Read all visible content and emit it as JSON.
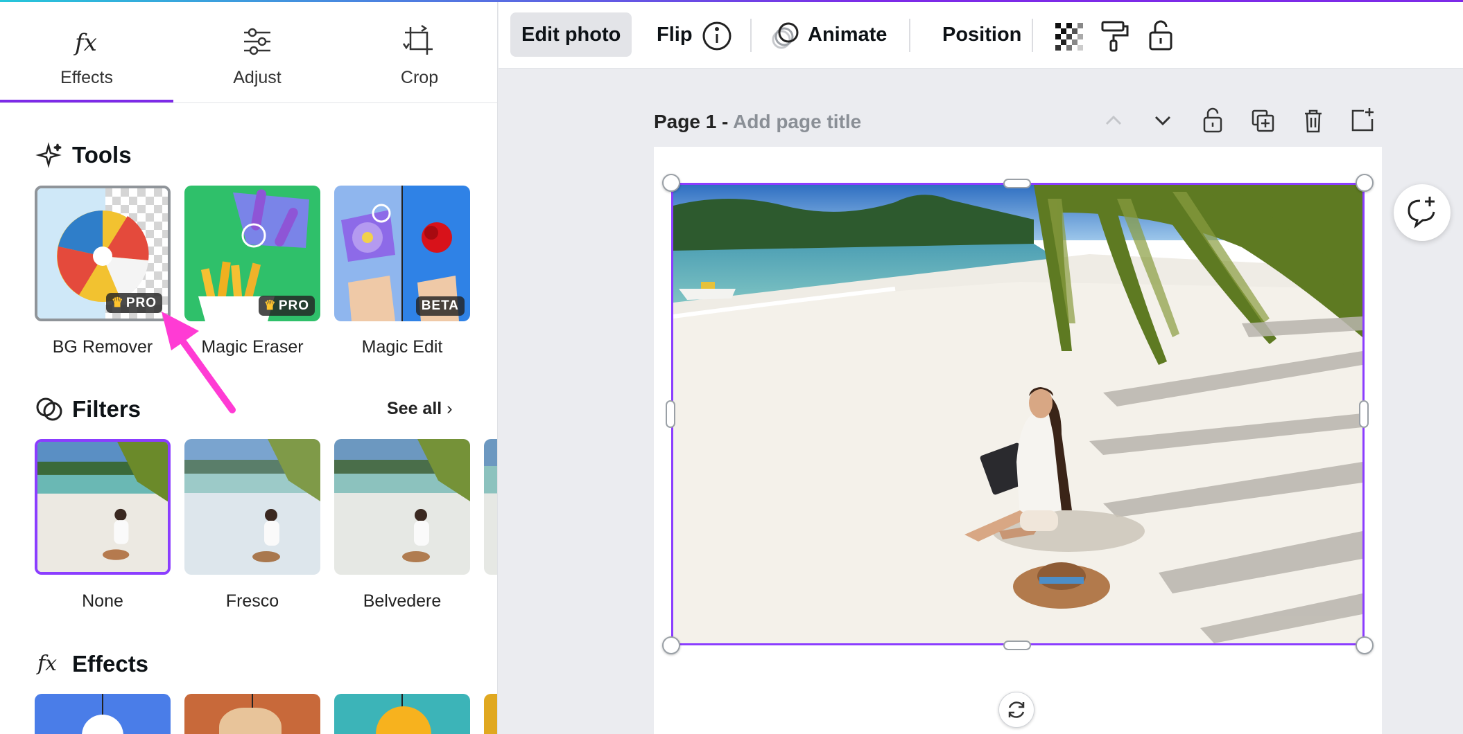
{
  "panel": {
    "tabs": [
      {
        "label": "Effects",
        "icon": "fx-icon",
        "active": true
      },
      {
        "label": "Adjust",
        "icon": "sliders-icon",
        "active": false
      },
      {
        "label": "Crop",
        "icon": "crop-icon",
        "active": false
      }
    ],
    "tools": {
      "title": "Tools",
      "items": [
        {
          "label": "BG Remover",
          "badge": "PRO"
        },
        {
          "label": "Magic Eraser",
          "badge": "PRO"
        },
        {
          "label": "Magic Edit",
          "badge": "BETA"
        }
      ]
    },
    "filters": {
      "title": "Filters",
      "see_all": "See all",
      "items": [
        {
          "label": "None"
        },
        {
          "label": "Fresco"
        },
        {
          "label": "Belvedere"
        }
      ]
    },
    "effects": {
      "title": "Effects"
    }
  },
  "toolbar": {
    "edit_photo": "Edit photo",
    "flip": "Flip",
    "animate": "Animate",
    "position": "Position"
  },
  "canvas": {
    "page_label": "Page 1 - ",
    "page_title_placeholder": "Add page title"
  },
  "colors": {
    "accent": "#8b3dff",
    "arrow": "#ff3bd4",
    "selection_border": "#8b3dff"
  }
}
